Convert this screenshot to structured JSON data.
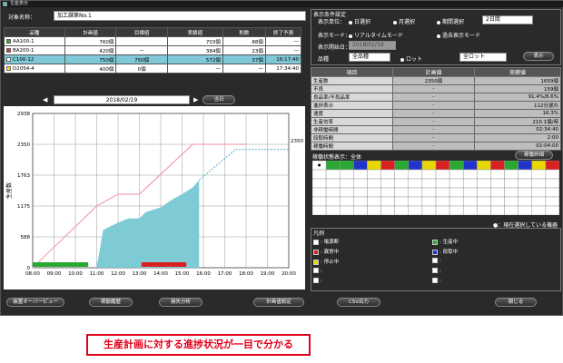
{
  "window": {
    "title": "生産表示"
  },
  "header": {
    "group_label": "対象名称：",
    "group_value": "加工課第No.1"
  },
  "items_table": {
    "columns": [
      "品種",
      "計画値",
      "目標値",
      "実績値",
      "削数",
      "終了予測"
    ],
    "rows": [
      {
        "color": "#33aa33",
        "name": "AA100-1",
        "plan": "760個",
        "target": "",
        "actual": "703個",
        "count": "88個",
        "end": "—",
        "selected": false
      },
      {
        "color": "#dd3333",
        "name": "BA200-1",
        "plan": "420個",
        "target": "—",
        "actual": "384個",
        "count": "23個",
        "end": "—",
        "selected": false
      },
      {
        "color": "#ffffff",
        "name": "C100-12",
        "plan": "750個",
        "target": "750個",
        "actual": "572個",
        "count": "37個",
        "end": "16:17:40",
        "selected": true
      },
      {
        "color": "#ffdd00",
        "name": "D2054-4",
        "plan": "400個",
        "target": "0個",
        "actual": "—",
        "count": "—",
        "end": "17:34:40",
        "selected": false
      }
    ]
  },
  "date_nav": {
    "prev": "◀",
    "date": "2018/02/19",
    "next": "▶",
    "today_button": "当日"
  },
  "chart_data": {
    "type": "area",
    "x_ticks": [
      "08:00",
      "09:00",
      "10:00",
      "11:00",
      "12:00",
      "13:00",
      "14:00",
      "15:00",
      "16:00",
      "17:00",
      "18:00",
      "19:00",
      "20:00"
    ],
    "ylim": [
      0,
      2938
    ],
    "y_ticks": [
      2938,
      2350,
      1763,
      1175,
      588,
      0
    ],
    "ylabel": "生産数",
    "end_label": "2350",
    "series": [
      {
        "type": "plan",
        "color": "#f4a0b0",
        "points": [
          [
            8.0,
            0
          ],
          [
            11.0,
            1175
          ],
          [
            12.0,
            1400
          ],
          [
            13.0,
            1400
          ],
          [
            15.5,
            2350
          ],
          [
            18.0,
            2350
          ]
        ]
      },
      {
        "type": "forecast",
        "color": "#55aacc",
        "points": [
          [
            15.8,
            1670
          ],
          [
            17.5,
            2250
          ],
          [
            20.0,
            2250
          ]
        ]
      },
      {
        "type": "actual",
        "color": "#7ecbd6",
        "points": [
          [
            11.0,
            0
          ],
          [
            11.3,
            720
          ],
          [
            12.0,
            860
          ],
          [
            12.5,
            940
          ],
          [
            13.0,
            940
          ],
          [
            13.3,
            1060
          ],
          [
            14.0,
            1150
          ],
          [
            14.5,
            1290
          ],
          [
            15.0,
            1400
          ],
          [
            15.5,
            1530
          ],
          [
            15.8,
            1670
          ]
        ]
      }
    ],
    "status_bars": [
      {
        "color": "#2aa832",
        "start": 8.0,
        "end": 10.6
      },
      {
        "color": "#7ecbd6",
        "start": 11.0,
        "end": 12.3
      },
      {
        "color": "#d82020",
        "start": 13.1,
        "end": 15.2
      }
    ]
  },
  "settings": {
    "title": "表示条件設定",
    "display_unit_label": "表示単位：",
    "unit_options": [
      "日選択",
      "月選択",
      "期間選択"
    ],
    "period_value": "2日間",
    "mode_label": "表示モード：",
    "mode_options": [
      "リアルタイムモード",
      "過去表示モード"
    ],
    "start_date_label": "表示開始日：",
    "start_date_value": "2018/02/19",
    "kind_label": "品種",
    "kind_value": "全品種",
    "lot_label": "ロット",
    "lot_value": "全ロット",
    "show_button": "表示"
  },
  "summary": {
    "columns": [
      "項目",
      "計画値",
      "実績値"
    ],
    "rows": [
      {
        "k": "生産数",
        "v": "2350個",
        "n": "1659個"
      },
      {
        "k": "不良",
        "v": "-",
        "n": "159個"
      },
      {
        "k": "良品率/不良品率",
        "v": "-",
        "n": "91.4%/8.6%"
      },
      {
        "k": "進捗表示",
        "v": "-",
        "n": "112分遅れ"
      },
      {
        "k": "速度",
        "v": "-",
        "n": "16.3%"
      },
      {
        "k": "生産効率",
        "v": "-",
        "n": "210.1個/時"
      },
      {
        "k": "非稼働時間",
        "v": "-",
        "n": "02:34:40"
      },
      {
        "k": "段取時間",
        "v": "-",
        "n": "2:00"
      },
      {
        "k": "稼働時間",
        "v": "-",
        "n": "02:04:00"
      }
    ]
  },
  "op_status": {
    "title": "稼働状態表示：全体",
    "detail_button": "稼働詳細",
    "note": "●：現在選択している機器"
  },
  "legend": {
    "title": "凡例",
    "items": [
      {
        "color": "#ffffff",
        "label": "電源断"
      },
      {
        "color": "#d82020",
        "label": "異常中"
      },
      {
        "color": "#e8d800",
        "label": "停止中"
      },
      {
        "color": "#ffffff",
        "label": ""
      },
      {
        "color": "#ffffff",
        "label": ""
      },
      {
        "color": "#2aa832",
        "label": "生産中"
      },
      {
        "color": "#2233cc",
        "label": "段取中"
      },
      {
        "color": "#ffffff",
        "label": ""
      },
      {
        "color": "#ffffff",
        "label": ""
      },
      {
        "color": "#ffffff",
        "label": ""
      }
    ]
  },
  "bottom_buttons": [
    "装置オーバービュー",
    "稼動履歴",
    "損失分析",
    "計画値設定",
    "CSV出力",
    "閉じる"
  ],
  "callout": "生産計画に対する進捗状況が一目で分かる"
}
